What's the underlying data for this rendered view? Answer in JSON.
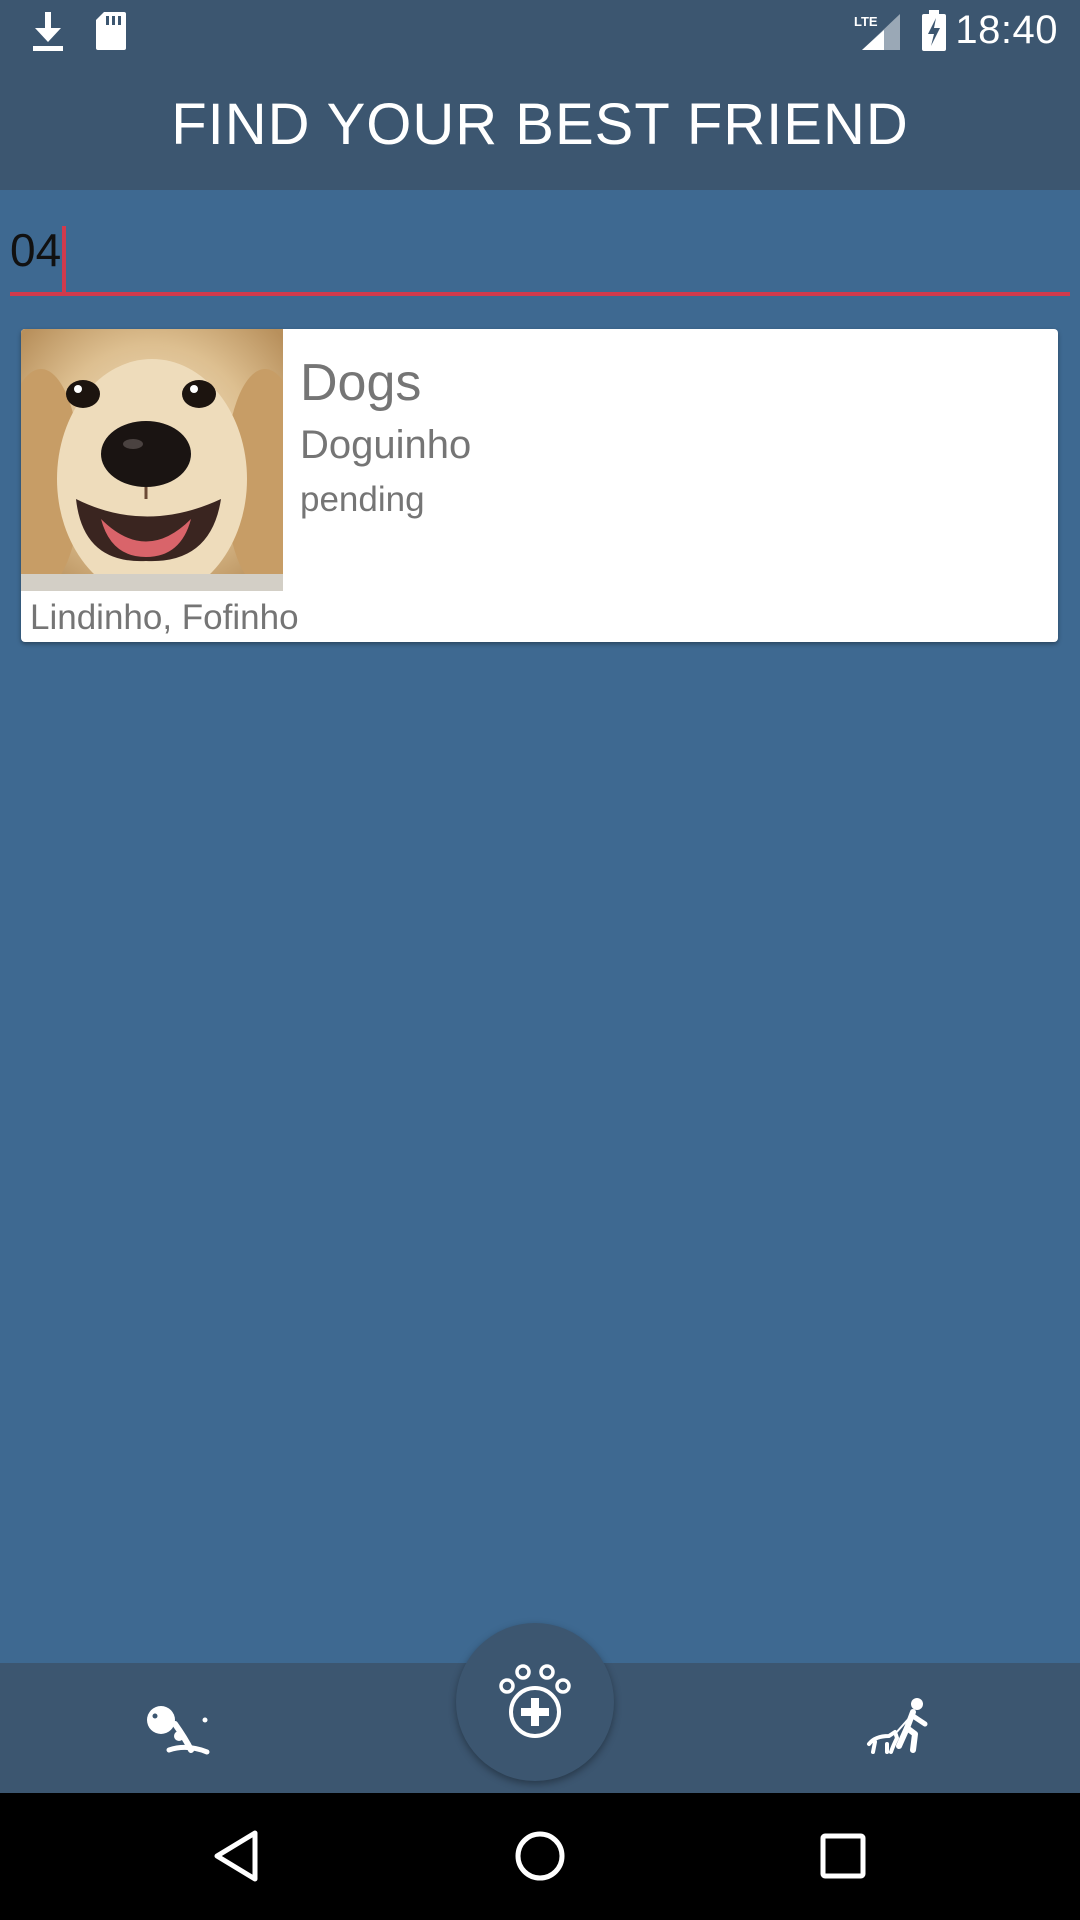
{
  "status_bar": {
    "time": "18:40",
    "network_label": "LTE",
    "icons": [
      "download-icon",
      "sd-card-icon",
      "signal-icon",
      "battery-charging-icon"
    ]
  },
  "app_bar": {
    "title": "FIND YOUR BEST FRIEND"
  },
  "search": {
    "value": "04",
    "underline_color": "#d23a4c"
  },
  "results": [
    {
      "category": "Dogs",
      "name": "Doguinho",
      "status": "pending",
      "tags": "Lindinho, Fofinho",
      "photo": "golden-retriever-photo"
    }
  ],
  "bottom_nav": {
    "left_icon": "dog-lying-icon",
    "center_icon": "paw-plus-icon",
    "right_icon": "person-walking-dog-icon"
  },
  "system_nav": {
    "icons": [
      "back-icon",
      "home-icon",
      "recents-icon"
    ]
  },
  "colors": {
    "background": "#3e6991",
    "bars": "#3c5670",
    "accent": "#d23a4c",
    "card": "#ffffff",
    "card_text": "#757575"
  }
}
